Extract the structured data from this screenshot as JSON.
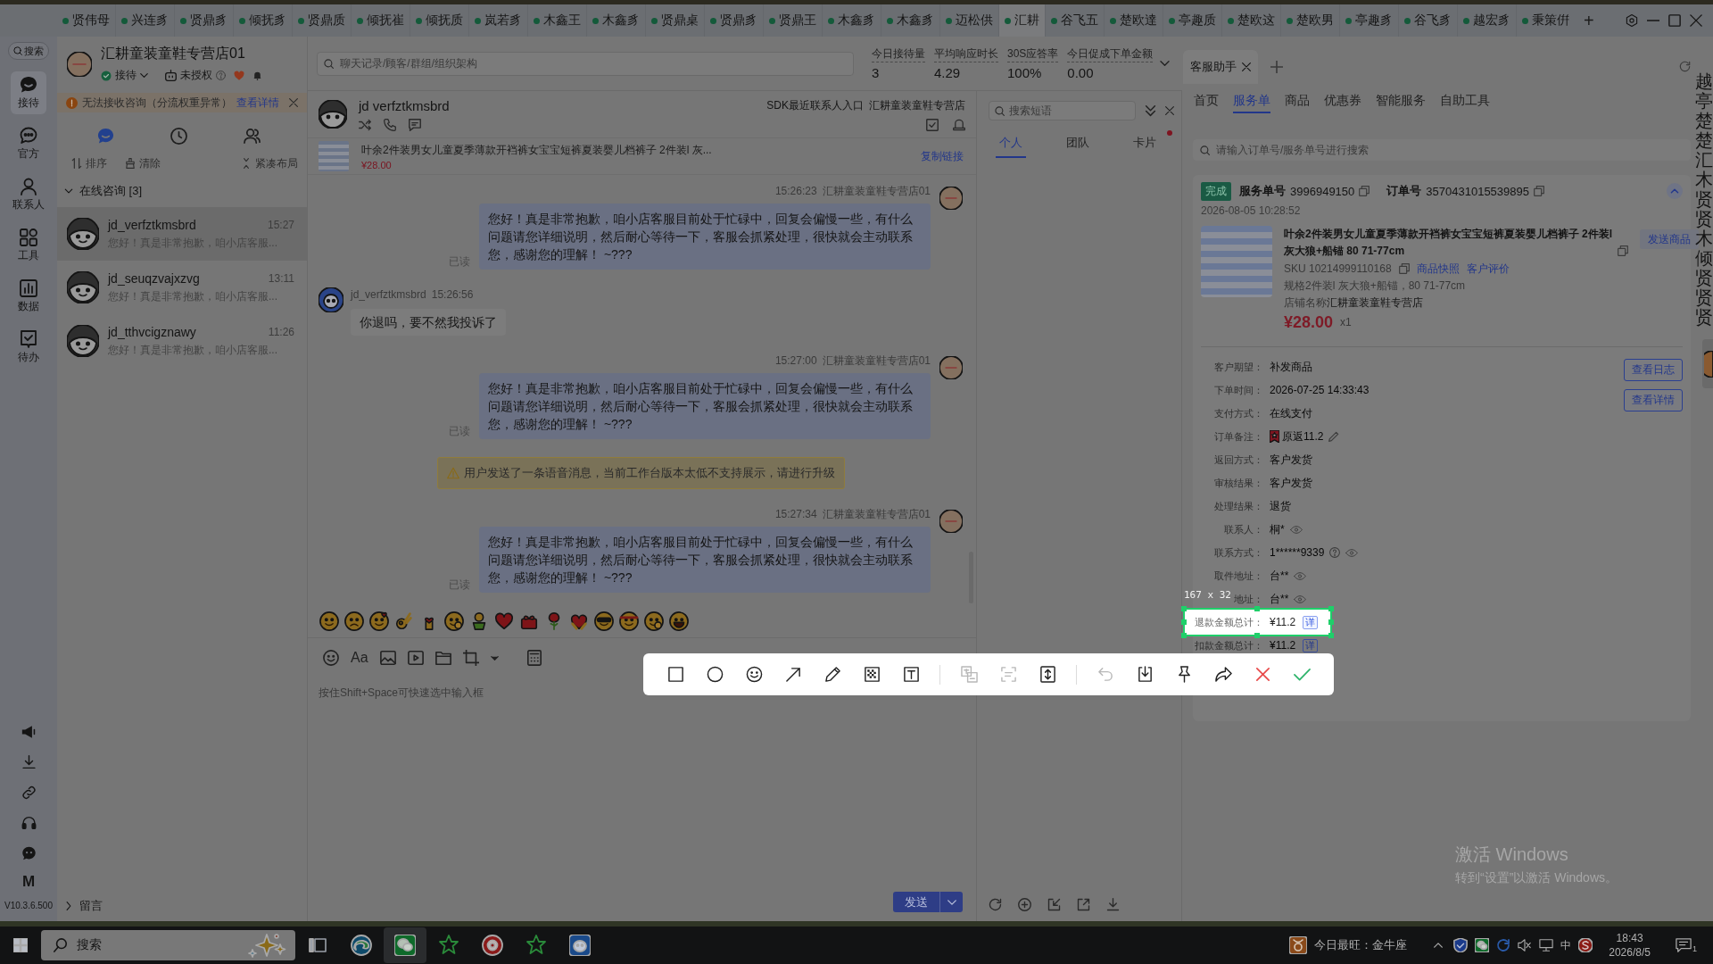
{
  "top_tabs": {
    "tabs": [
      {
        "label": "贤伟母",
        "selected": false
      },
      {
        "label": "兴连豸",
        "selected": false
      },
      {
        "label": "贤鼎豸",
        "selected": false
      },
      {
        "label": "倾抚豸",
        "selected": false
      },
      {
        "label": "贤鼎质",
        "selected": false
      },
      {
        "label": "倾抚崔",
        "selected": false
      },
      {
        "label": "倾抚质",
        "selected": false
      },
      {
        "label": "岚若豸",
        "selected": false
      },
      {
        "label": "木鑫王",
        "selected": false
      },
      {
        "label": "木鑫豸",
        "selected": false
      },
      {
        "label": "贤鼎桌",
        "selected": false
      },
      {
        "label": "贤鼎豸",
        "selected": false
      },
      {
        "label": "贤鼎王",
        "selected": false
      },
      {
        "label": "木鑫豸",
        "selected": false
      },
      {
        "label": "木鑫豸",
        "selected": false
      },
      {
        "label": "迈松供",
        "selected": false
      },
      {
        "label": "汇耕",
        "selected": true
      },
      {
        "label": "谷飞五",
        "selected": false
      },
      {
        "label": "楚欧達",
        "selected": false
      },
      {
        "label": "亭趣质",
        "selected": false
      },
      {
        "label": "楚欧这",
        "selected": false
      },
      {
        "label": "楚欧男",
        "selected": false
      },
      {
        "label": "亭趣豸",
        "selected": false
      },
      {
        "label": "谷飞豸",
        "selected": false
      },
      {
        "label": "越宏豸",
        "selected": false
      },
      {
        "label": "秉策倂",
        "selected": false
      }
    ],
    "add": "+"
  },
  "sidebar": {
    "search": "搜索",
    "items": [
      {
        "kind": "reception",
        "label": "接待",
        "selected": true
      },
      {
        "kind": "official",
        "label": "官方",
        "selected": false
      },
      {
        "kind": "contacts",
        "label": "联系人",
        "selected": false
      },
      {
        "kind": "tools",
        "label": "工具",
        "selected": false
      },
      {
        "kind": "data",
        "label": "数据",
        "selected": false
      },
      {
        "kind": "todo",
        "label": "待办",
        "selected": false
      }
    ],
    "shortcut_label": "M",
    "version": "V10.3.6.500"
  },
  "conversations_panel": {
    "shop_name": "汇耕童装童鞋专营店01",
    "status": "接待",
    "auth": "未授权",
    "warning": {
      "text": "无法接收咨询（分流权重异常）",
      "link": "查看详情"
    },
    "view_tabs": [
      {
        "kind": "chats",
        "selected": true
      },
      {
        "kind": "history",
        "selected": false
      },
      {
        "kind": "contacts",
        "selected": false
      }
    ],
    "actions": [
      {
        "kind": "sort",
        "label": "排序"
      },
      {
        "kind": "clear",
        "label": "清除"
      },
      {
        "kind": "compact",
        "label": "紧凑布局"
      }
    ],
    "groups": [
      {
        "title": "在线咨询 [3]",
        "expanded": true,
        "items": [
          {
            "name": "jd_verfztkmsbrd",
            "time": "15:27",
            "preview": "您好！真是非常抱歉，咱小店客服...",
            "selected": true
          },
          {
            "name": "jd_seuqzvajxzvg",
            "time": "13:11",
            "preview": "您好！真是非常抱歉，咱小店客服...",
            "selected": false
          },
          {
            "name": "jd_tthvcigznawy",
            "time": "11:26",
            "preview": "您好！真是非常抱歉，咱小店客服...",
            "selected": false
          }
        ]
      },
      {
        "title": "留言",
        "expanded": false
      }
    ]
  },
  "chat": {
    "search_placeholder": "聊天记录/顾客/群组/组织架构",
    "stats": [
      {
        "label": "今日接待量",
        "value": "3"
      },
      {
        "label": "平均响应时长",
        "value": "4.29"
      },
      {
        "label": "30S应答率",
        "value": "100%"
      },
      {
        "label": "今日促成下单金额",
        "value": "0.00"
      }
    ],
    "customer": "jd verfztkmsbrd",
    "source": "SDK最近联系人入口",
    "shop": "汇耕童装童鞋专营店",
    "product": {
      "title": "叶余2件装男女儿童夏季薄款开裆裤女宝宝短裤夏装婴儿档裤子 2件装l 灰...",
      "price": "¥28.00",
      "link": "复制链接"
    },
    "messages": [
      {
        "kind": "agent",
        "time": "15:26:23",
        "sender": "汇耕童装童鞋专营店01",
        "text": "您好！真是非常抱歉，咱小店客服目前处于忙碌中，回复会偏慢一些，有什么问题请您详细说明，然后耐心等待一下，客服会抓紧处理，很快就会主动联系您，感谢您的理解！ ~???",
        "receipt": "已读"
      },
      {
        "kind": "customer",
        "sender": "jd_verfztkmsbrd",
        "time": "15:26:56",
        "text": "你退吗，要不然我投诉了"
      },
      {
        "kind": "agent",
        "time": "15:27:00",
        "sender": "汇耕童装童鞋专营店01",
        "text": "您好！真是非常抱歉，咱小店客服目前处于忙碌中，回复会偏慢一些，有什么问题请您详细说明，然后耐心等待一下，客服会抓紧处理，很快就会主动联系您，感谢您的理解！ ~???",
        "receipt": "已读"
      },
      {
        "kind": "notice",
        "text": "用户发送了一条语音消息，当前工作台版本太低不支持展示，请进行升级"
      },
      {
        "kind": "agent",
        "time": "15:27:34",
        "sender": "汇耕童装童鞋专营店01",
        "text": "您好！真是非常抱歉，咱小店客服目前处于忙碌中，回复会偏慢一些，有什么问题请您详细说明，然后耐心等待一下，客服会抓紧处理，很快就会主动联系您，感谢您的理解！ ~???",
        "receipt": "已读"
      }
    ],
    "font_button": "Aa",
    "input_placeholder": "按住Shift+Space可快速选中输入框",
    "send": "发送"
  },
  "quick_replies": {
    "search_placeholder": "搜索短语",
    "tabs": [
      {
        "label": "个人",
        "selected": true,
        "unread": false
      },
      {
        "label": "团队",
        "selected": false,
        "unread": false
      },
      {
        "label": "卡片",
        "selected": false,
        "unread": true
      }
    ]
  },
  "assistant": {
    "tabs": [
      {
        "label": "客服助手",
        "selected": true
      }
    ],
    "nav": [
      {
        "label": "首页",
        "selected": false
      },
      {
        "label": "服务单",
        "selected": true
      },
      {
        "label": "商品",
        "selected": false
      },
      {
        "label": "优惠券",
        "selected": false
      },
      {
        "label": "智能服务",
        "selected": false
      },
      {
        "label": "自助工具",
        "selected": false
      }
    ],
    "search_placeholder": "请输入订单号/服务单号进行搜索",
    "order": {
      "status": "完成",
      "service_label": "服务单号",
      "service_no": "3996949150",
      "order_label": "订单号",
      "order_no": "3570431015539895",
      "created": "2026-08-05 10:28:52",
      "product": {
        "title": "叶余2件装男女儿童夏季薄款开裆裤女宝宝短裤夏装婴儿档裤子 2件装l 灰大狼+船锚 80 71-77cm",
        "sku": "SKU 10214999110168",
        "links": [
          "商品快照",
          "客户评价"
        ],
        "spec": "规格2件装l 灰大狼+船锚，80 71-77cm",
        "shop_label": "店铺名称",
        "shop": "汇耕童装童鞋专营店",
        "price": "¥28.00",
        "quantity": "x1",
        "send": "发送商品"
      },
      "actions": [
        "查看日志",
        "查看详情"
      ],
      "fields": [
        {
          "kind": "text",
          "label": "客户期望：",
          "value": "补发商品",
          "in_selection": false
        },
        {
          "kind": "text",
          "label": "下单时间：",
          "value": "2026-07-25 14:33:43",
          "in_selection": false
        },
        {
          "kind": "text",
          "label": "支付方式：",
          "value": "在线支付",
          "in_selection": false
        },
        {
          "kind": "note",
          "label": "订单备注：",
          "value": "原返11.2",
          "in_selection": false
        },
        {
          "kind": "text",
          "label": "返回方式：",
          "value": "客户发货",
          "in_selection": false
        },
        {
          "kind": "text",
          "label": "审核结果：",
          "value": "客户发货",
          "in_selection": false
        },
        {
          "kind": "text",
          "label": "处理结果：",
          "value": "退货",
          "in_selection": false
        },
        {
          "kind": "masked",
          "label": "联系人：",
          "value": "桐*",
          "in_selection": false
        },
        {
          "kind": "phone",
          "label": "联系方式：",
          "value": "1******9339",
          "in_selection": false
        },
        {
          "kind": "masked",
          "label": "取件地址：",
          "value": "台**",
          "in_selection": false
        },
        {
          "kind": "masked",
          "label": "地址：",
          "value": "台**",
          "in_selection": false
        },
        {
          "kind": "amount",
          "label": "退款金额总计：",
          "value": "¥11.2",
          "detail": "详",
          "in_selection": true
        },
        {
          "kind": "amount",
          "label": "扣款金额总计：",
          "value": "¥11.2",
          "detail": "详",
          "in_selection": false
        }
      ]
    }
  },
  "side_strip": "越亭楚楚汇木贤贤木倾贤贤贤",
  "capture": {
    "size": "167 x 32",
    "tool_groups": [
      [
        {
          "kind": "rectangle",
          "disabled": false
        },
        {
          "kind": "ellipse",
          "disabled": false
        },
        {
          "kind": "emoji",
          "disabled": false
        },
        {
          "kind": "arrow",
          "disabled": false
        },
        {
          "kind": "pen",
          "disabled": false
        },
        {
          "kind": "mosaic",
          "disabled": false
        },
        {
          "kind": "text",
          "disabled": false
        }
      ],
      [
        {
          "kind": "translate",
          "disabled": true
        },
        {
          "kind": "ocr",
          "disabled": true
        },
        {
          "kind": "scroll",
          "disabled": false
        }
      ],
      [
        {
          "kind": "undo",
          "disabled": true
        },
        {
          "kind": "save",
          "disabled": false
        },
        {
          "kind": "pin",
          "disabled": false
        },
        {
          "kind": "share",
          "disabled": false
        },
        {
          "kind": "cancel",
          "disabled": false
        },
        {
          "kind": "confirm",
          "disabled": false
        }
      ]
    ]
  },
  "taskbar": {
    "search": "搜索",
    "apps": [
      {
        "kind": "task-view",
        "active": false
      },
      {
        "kind": "browser",
        "active": false
      },
      {
        "kind": "chat",
        "active": true
      },
      {
        "kind": "star",
        "active": false
      },
      {
        "kind": "red-app",
        "active": false
      },
      {
        "kind": "star",
        "active": false
      },
      {
        "kind": "blue-app",
        "active": false
      }
    ],
    "widget": "今日最旺：金牛座",
    "ime": "中",
    "time": "18:43",
    "date": "2026/8/5",
    "notifications": "1"
  },
  "activation": {
    "title": "激活 Windows",
    "text": "转到“设置”以激活 Windows。"
  }
}
